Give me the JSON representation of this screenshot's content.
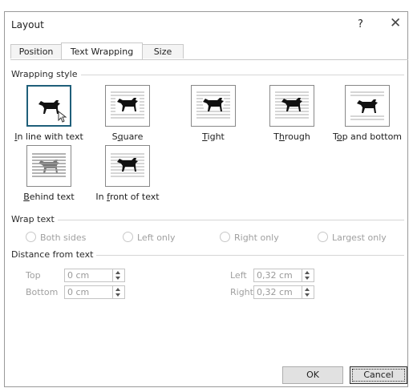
{
  "dialog": {
    "title": "Layout",
    "help": "?",
    "close": "✕"
  },
  "tabs": [
    {
      "label": "Position"
    },
    {
      "label": "Text Wrapping"
    },
    {
      "label": "Size"
    }
  ],
  "wrapping_style": {
    "heading": "Wrapping style",
    "options": [
      {
        "u": "I",
        "rest": "n line with text"
      },
      {
        "pre": "S",
        "u": "q",
        "rest": "uare"
      },
      {
        "u": "T",
        "rest": "ight"
      },
      {
        "pre": "T",
        "u": "h",
        "rest": "rough"
      },
      {
        "pre": "T",
        "u": "o",
        "rest": "p and bottom"
      },
      {
        "u": "B",
        "rest": "ehind text"
      },
      {
        "pre": "In ",
        "u": "f",
        "rest": "ront of text"
      }
    ]
  },
  "wrap_text": {
    "heading": "Wrap text",
    "options": [
      "Both sides",
      "Left only",
      "Right only",
      "Largest only"
    ]
  },
  "distance": {
    "heading": "Distance from text",
    "top": {
      "label": "Top",
      "value": "0 cm"
    },
    "bottom": {
      "label": "Bottom",
      "value": "0 cm"
    },
    "left": {
      "label": "Left",
      "value": "0,32 cm"
    },
    "right": {
      "label": "Right",
      "value": "0,32 cm"
    }
  },
  "buttons": {
    "ok": "OK",
    "cancel": "Cancel"
  }
}
